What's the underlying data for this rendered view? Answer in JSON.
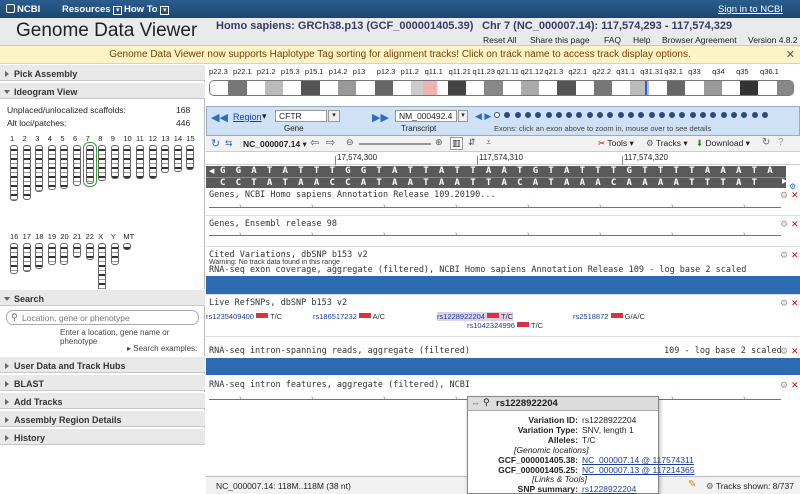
{
  "top": {
    "brand": "NCBI",
    "resources": "Resources",
    "howto": "How To",
    "signin": "Sign in to NCBI"
  },
  "header": {
    "title": "Genome Data Viewer",
    "assembly": "Homo sapiens: GRCh38.p13 (GCF_000001405.39)",
    "location": "Chr 7 (NC_000007.14):  117,574,293 - 117,574,329",
    "links": [
      "Reset All",
      "Share this page",
      "FAQ",
      "Help",
      "Browser Agreement",
      "Version 4.8.2"
    ]
  },
  "notice": "Genome Data Viewer now supports Haplotype Tag sorting for alignment tracks! Click on track name to access track display options.",
  "left": {
    "pick": "Pick Assembly",
    "ideogram": "Ideogram View",
    "unplaced_label": "Unplaced/unlocalized scaffolds:",
    "unplaced_val": "168",
    "alt_label": "Alt loci/patches:",
    "alt_val": "446",
    "chroms": [
      "1",
      "2",
      "3",
      "4",
      "5",
      "6",
      "7",
      "8",
      "9",
      "10",
      "11",
      "12",
      "13",
      "14",
      "15",
      "16",
      "17",
      "18",
      "19",
      "20",
      "21",
      "22",
      "X",
      "Y",
      "MT"
    ],
    "search": "Search",
    "search_placeholder": "Location, gene or phenotype",
    "search_hint": "Enter a location, gene name or phenotype",
    "search_examples": "Search examples:",
    "sections": [
      "User Data and Track Hubs",
      "BLAST",
      "Add Tracks",
      "Assembly Region Details",
      "History"
    ]
  },
  "bands": [
    "p22.3",
    "p22.1",
    "p21.2",
    "p15.3",
    "p15.1",
    "p14.2",
    "p13",
    "p12.3",
    "p11.2",
    "q11.1",
    "q11.21",
    "q11.23",
    "q21.11",
    "q21.12",
    "q21.3",
    "q22.1",
    "q22.2",
    "q31.1",
    "q31.31",
    "q32.1",
    "q33",
    "q34",
    "q35",
    "q36.1"
  ],
  "nav": {
    "region": "Region",
    "gene_value": "CFTR",
    "gene_label": "Gene",
    "transcript_value": "NM_000492.4",
    "transcript_label": "Transcript",
    "exons_hint": "Exons: click an exon above to zoom in, mouse over to see details"
  },
  "toolbar": {
    "seqid": "NC_000007.14",
    "tools": "Tools",
    "tracks": "Tracks",
    "download": "Download"
  },
  "ruler": [
    "17,574,300",
    "117,574,310",
    "117,574,320"
  ],
  "seq_fwd": "G G A T A T T T G G T A T T A T T A A T G T A T T T G T T T T A A A T A",
  "seq_rev": "C C T A T A A C C A T A A T A A T T A C A T A A A C A A A A T T T A T",
  "tracks": {
    "genes_ncbi": "Genes, NCBI Homo sapiens Annotation Release 109.20190...",
    "genes_ens": "Genes, Ensembl release 98",
    "cited": "Cited Variations, dbSNP b153 v2",
    "cited_warn": "Warning: No track data found in this range",
    "rnaseq": "RNA-seq exon coverage, aggregate (filtered), NCBI Homo sapiens Annotation Release 109 - log base 2 scaled",
    "live": "Live RefSNPs, dbSNP b153 v2",
    "intron_span": "RNA-seq intron-spanning reads, aggregate (filtered)",
    "intron_span_end": "109 - log base 2 scaled",
    "intron_feat": "RNA-seq intron features, aggregate (filtered), NCBI"
  },
  "snps": [
    {
      "id": "rs1235409400",
      "allele": "T/C"
    },
    {
      "id": "rs186517232",
      "allele": "A/C"
    },
    {
      "id": "rs1228922204",
      "allele": "T/C"
    },
    {
      "id": "rs2518872",
      "allele": "G/A/C"
    },
    {
      "id": "rs1042324996",
      "allele": "T/C"
    }
  ],
  "popup": {
    "title": "rs1228922204",
    "variation_id_k": "Variation ID:",
    "variation_id": "rs1228922204",
    "type_k": "Variation Type:",
    "type": "SNV, length 1",
    "alleles_k": "Alleles:",
    "alleles": "T/C",
    "genomic": "[Genomic locations]",
    "loc1_k": "GCF_000001405.38:",
    "loc1": "NC_000007.14 @ 117574311",
    "loc2_k": "GCF_000001405.25:",
    "loc2": "NC_000007.13 @ 117214365",
    "links": "[Links & Tools]",
    "summary_k": "SNP summary:",
    "summary": "rs1228922204"
  },
  "status": {
    "pos": "NC_000007.14: 118M..118M (38 nt)",
    "tracks_shown": "Tracks shown: 8/737"
  },
  "colors": {
    "topbar": "#1f4e79",
    "notice_bg": "#fcf3c6",
    "nav_bg": "#cfe2f5",
    "rna": "#2c6bb3",
    "snp": "#d9343c",
    "gene": "#3b9b3b"
  }
}
